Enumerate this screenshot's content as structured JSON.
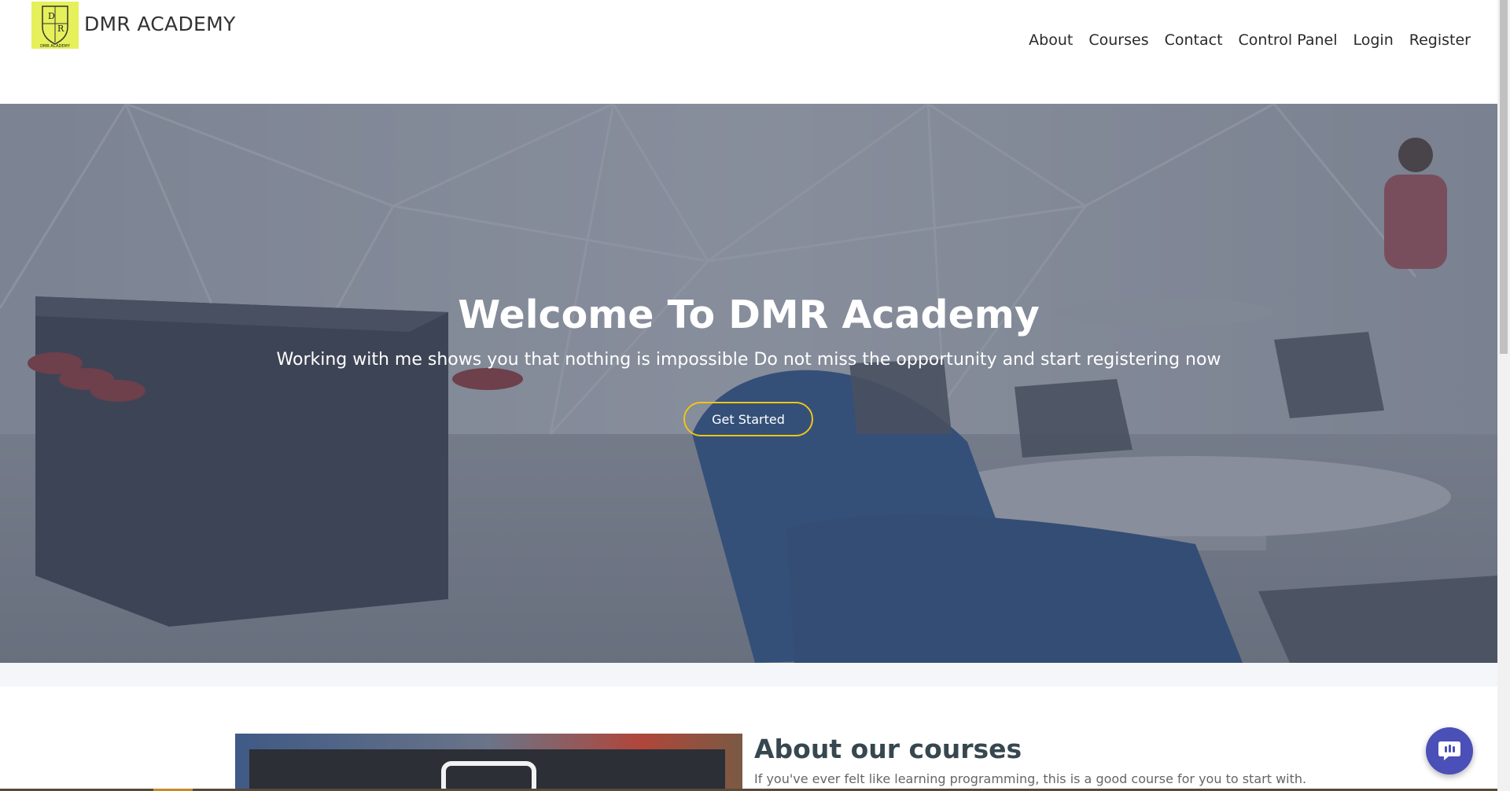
{
  "header": {
    "brand_name": "DMR ACADEMY",
    "logo_letters": [
      "D",
      "R"
    ],
    "logo_caption": "DMR ACADEMY",
    "nav": [
      "About",
      "Courses",
      "Contact",
      "Control Panel",
      "Login",
      "Register"
    ]
  },
  "hero": {
    "title": "Welcome To DMR Academy",
    "subtitle": "Working with me shows you that nothing is impossible Do not miss the opportunity and start registering now",
    "cta_label": "Get Started"
  },
  "about": {
    "title": "About our courses",
    "text": "If you've ever felt like learning programming, this is a good course for you to start with."
  },
  "colors": {
    "logo_bg": "#e6f05a",
    "cta_border": "#f0c419",
    "chat_bg": "#4a50b8",
    "about_title": "#37474f"
  },
  "icons": {
    "chat": "chat-bubble-icon"
  }
}
